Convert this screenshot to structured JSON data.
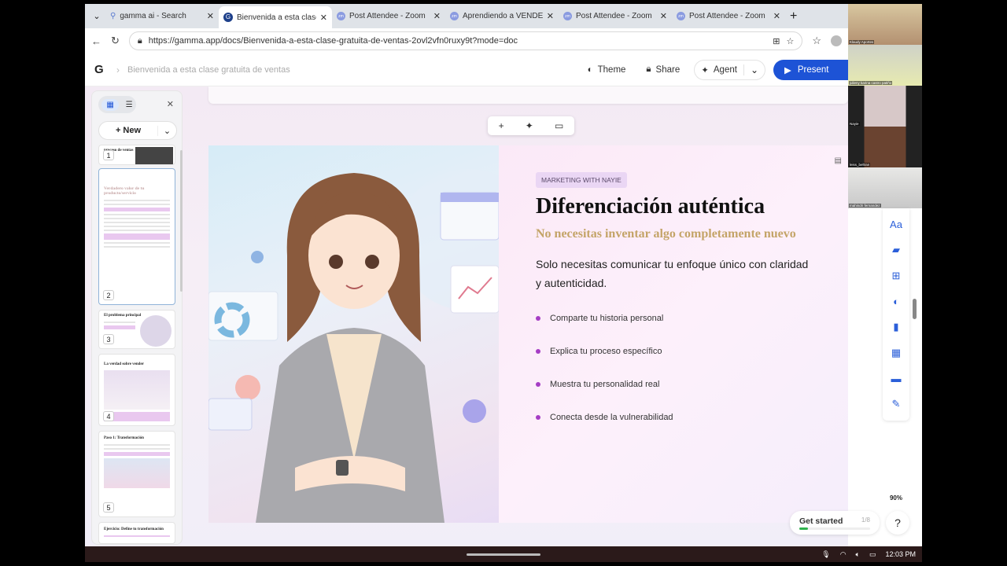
{
  "browser": {
    "tabs": [
      {
        "label": "gamma ai - Search",
        "icon": "search-icon"
      },
      {
        "label": "Bienvenida a esta clase gratuita de ventas",
        "icon": "gamma-icon",
        "active": true
      },
      {
        "label": "Post Attendee - Zoom",
        "icon": "zoom-icon"
      },
      {
        "label": "Aprendiendo a VENDER",
        "icon": "zoom-icon"
      },
      {
        "label": "Post Attendee - Zoom",
        "icon": "zoom-icon"
      },
      {
        "label": "Post Attendee - Zoom",
        "icon": "zoom-icon"
      }
    ],
    "url": "https://gamma.app/docs/Bienvenida-a-esta-clase-gratuita-de-ventas-2ovl2vfn0ruxy9t?mode=doc"
  },
  "header": {
    "logo": "G",
    "breadcrumb": "Bienvenida a esta clase gratuita de ventas",
    "theme": "Theme",
    "share": "Share",
    "agent": "Agent",
    "present": "Present"
  },
  "sidebar": {
    "new_label": "New",
    "slides": [
      {
        "num": "1",
        "title": "proceso de ventas"
      },
      {
        "num": "2",
        "title": "Verdadero valor de tu producto/servicio"
      },
      {
        "num": "3",
        "title": "El problema principal"
      },
      {
        "num": "4",
        "title": "La verdad sobre vender"
      },
      {
        "num": "5",
        "title": "Paso 1: Transformación"
      },
      {
        "num": "",
        "title": "Ejercicio: Define tu transformación"
      }
    ]
  },
  "slide": {
    "tag": "MARKETING WITH NAYIE",
    "title": "Diferenciación auténtica",
    "subtitle": "No necesitas inventar algo completamente nuevo",
    "body": "Solo necesitas comunicar tu enfoque único con claridad y autenticidad.",
    "bullets": [
      "Comparte tu historia personal",
      "Explica tu proceso específico",
      "Muestra tu personalidad real",
      "Conecta desde la vulnerabilidad"
    ],
    "bullet_color": "#a53dc4"
  },
  "participants": [
    "Klaudy Aportes",
    "julieny karina castro patiño",
    "Nayie",
    "leiss_beltran",
    "mahindri fernandez"
  ],
  "zoom_level": "90%",
  "get_started": {
    "label": "Get started",
    "progress_text": "1/8",
    "progress": 0.125
  },
  "help": "?",
  "taskbar": {
    "time": "12:03 PM"
  }
}
